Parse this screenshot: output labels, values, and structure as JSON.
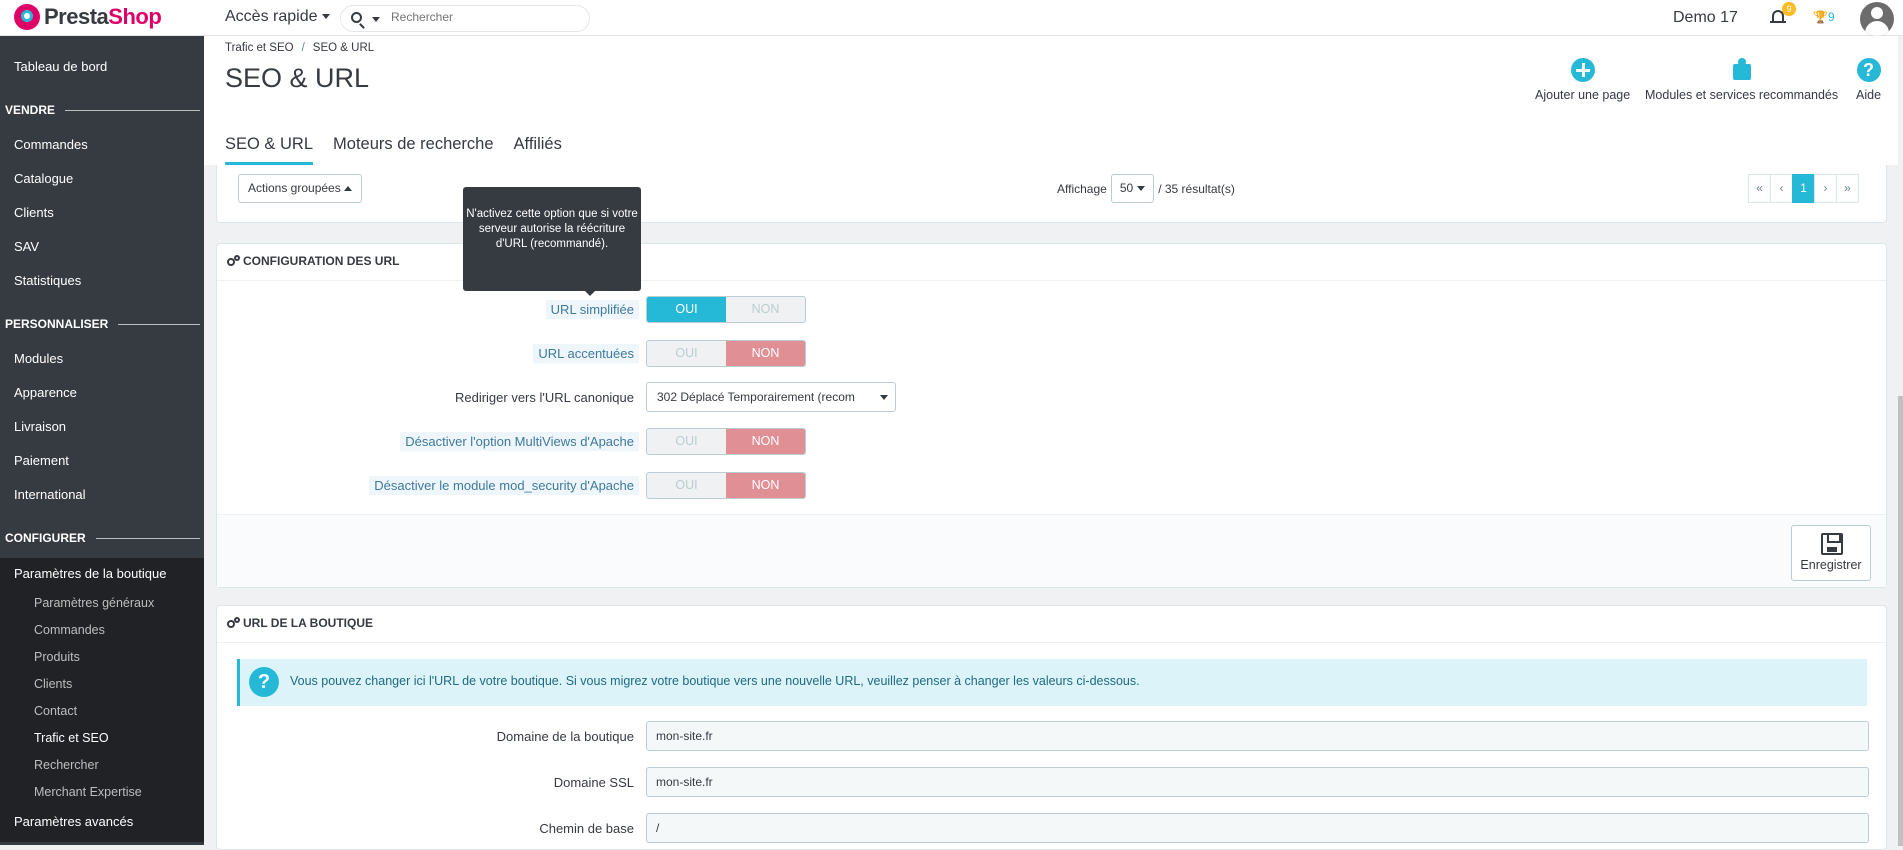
{
  "topbar": {
    "logo_presta": "Presta",
    "logo_shop": "Shop",
    "quick_access": "Accès rapide",
    "search_placeholder": "Rechercher",
    "shop_name": "Demo 17",
    "notif_count": "9",
    "trophy_count": "9"
  },
  "sidebar": {
    "dashboard": "Tableau de bord",
    "sections": {
      "sell": "VENDRE",
      "customize": "PERSONNALISER",
      "configure": "CONFIGURER"
    },
    "sell_items": [
      "Commandes",
      "Catalogue",
      "Clients",
      "SAV",
      "Statistiques"
    ],
    "customize_items": [
      "Modules",
      "Apparence",
      "Livraison",
      "Paiement",
      "International"
    ],
    "shop_params": "Paramètres de la boutique",
    "shop_params_sub": [
      "Paramètres généraux",
      "Commandes",
      "Produits",
      "Clients",
      "Contact",
      "Trafic et SEO",
      "Rechercher",
      "Merchant Expertise"
    ],
    "advanced": "Paramètres avancés"
  },
  "header": {
    "breadcrumb_parent": "Trafic et SEO",
    "breadcrumb_sep": "/",
    "breadcrumb_current": "SEO & URL",
    "title": "SEO & URL",
    "add_page": "Ajouter une page",
    "modules": "Modules et services recommandés",
    "help": "Aide",
    "help_glyph": "?",
    "tabs": [
      "SEO & URL",
      "Moteurs de recherche",
      "Affiliés"
    ]
  },
  "list_panel": {
    "bulk_actions": "Actions groupées",
    "display_label": "Affichage",
    "per_page": "50",
    "results": "/ 35 résultat(s)",
    "pages": [
      "«",
      "‹",
      "1",
      "›",
      "»"
    ]
  },
  "url_config": {
    "title": "CONFIGURATION DES URL",
    "tooltip": "N'activez cette option que si votre serveur autorise la réécriture d'URL (recommandé).",
    "yes": "OUI",
    "no": "NON",
    "friendly_url": "URL simplifiée",
    "accented_url": "URL accentuées",
    "canonical_label": "Rediriger vers l'URL canonique",
    "canonical_value": "302 Déplacé Temporairement (recom",
    "multiviews": "Désactiver l'option MultiViews d'Apache",
    "mod_security": "Désactiver le module mod_security d'Apache",
    "save": "Enregistrer"
  },
  "shop_url": {
    "title": "URL DE LA BOUTIQUE",
    "alert_glyph": "?",
    "alert": "Vous pouvez changer ici l'URL de votre boutique. Si vous migrez votre boutique vers une nouvelle URL, veuillez penser à changer les valeurs ci-dessous.",
    "domain_label": "Domaine de la boutique",
    "domain_value": "mon-site.fr",
    "ssl_label": "Domaine SSL",
    "ssl_value": "mon-site.fr",
    "base_label": "Chemin de base",
    "base_value": "/"
  },
  "colors": {
    "accent": "#25b9d7",
    "brand": "#df0067",
    "sidebar": "#363a41",
    "danger": "#e08f95"
  }
}
